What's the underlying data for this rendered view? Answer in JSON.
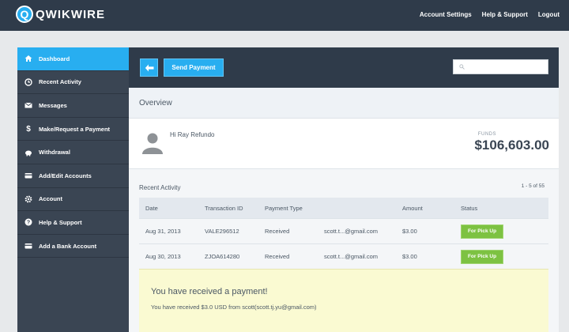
{
  "brand": {
    "badge": "Q",
    "name": "QWIKWIRE"
  },
  "topnav": {
    "account_settings": "Account Settings",
    "help": "Help & Support",
    "logout": "Logout"
  },
  "sidebar": {
    "items": [
      {
        "label": "Dashboard",
        "icon": "home-icon"
      },
      {
        "label": "Recent Activity",
        "icon": "clock-icon"
      },
      {
        "label": "Messages",
        "icon": "envelope-icon"
      },
      {
        "label": "Make/Request a Payment",
        "icon": "dollar-icon"
      },
      {
        "label": "Withdrawal",
        "icon": "piggy-bank-icon"
      },
      {
        "label": "Add/Edit Accounts",
        "icon": "card-icon"
      },
      {
        "label": "Account",
        "icon": "gear-icon"
      },
      {
        "label": "Help & Support",
        "icon": "question-icon"
      },
      {
        "label": "Add a Bank Account",
        "icon": "bank-card-icon"
      }
    ]
  },
  "toolbar": {
    "send_label": "Send Payment",
    "search_placeholder": ""
  },
  "overview": {
    "title": "Overview"
  },
  "profile": {
    "greeting": "Hi Ray Refundo",
    "funds_label": "FUNDS",
    "funds_value": "$106,603.00"
  },
  "activity": {
    "title": "Recent Activity",
    "count": "1 - 5 of 55",
    "columns": [
      "Date",
      "Transaction ID",
      "Payment Type",
      "",
      "Amount",
      "Status"
    ],
    "rows": [
      {
        "date": "Aug 31, 2013",
        "id": "VALE296512",
        "type": "Received",
        "email": "scott.t...@gmail.com",
        "amount": "$3.00",
        "status": "For Pick Up"
      },
      {
        "date": "Aug 30, 2013",
        "id": "ZJOA614280",
        "type": "Received",
        "email": "scott.t...@gmail.com",
        "amount": "$3.00",
        "status": "For Pick Up"
      }
    ]
  },
  "notice": {
    "title": "You have received a payment!",
    "message": "You have received $3.0 USD from scott(scott.tj.yu@gmail.com)"
  },
  "colors": {
    "accent": "#28aef0",
    "topbar": "#2f3b4a",
    "sidebar": "#3a4553",
    "status_green": "#7dc242",
    "notice_bg": "#fafad2"
  }
}
